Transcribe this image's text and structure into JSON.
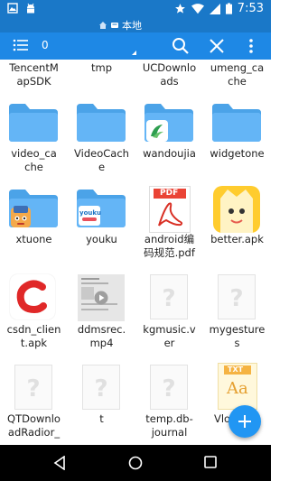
{
  "status": {
    "time": "7:53"
  },
  "tab": {
    "label": "本地"
  },
  "toolbar": {
    "selected_count": "0"
  },
  "files": [
    {
      "name": "TencentMapSDK",
      "lines": [
        "TencentM",
        "apSDK"
      ],
      "kind": "folder"
    },
    {
      "name": "tmp",
      "lines": [
        "tmp"
      ],
      "kind": "folder"
    },
    {
      "name": "UCDownloads",
      "lines": [
        "UCDownlo",
        "ads"
      ],
      "kind": "folder"
    },
    {
      "name": "umeng_cache",
      "lines": [
        "umeng_ca",
        "che"
      ],
      "kind": "folder"
    },
    {
      "name": "video_cache",
      "lines": [
        "video_ca",
        "che"
      ],
      "kind": "folder"
    },
    {
      "name": "VideoCache",
      "lines": [
        "VideoCach",
        "e"
      ],
      "kind": "folder"
    },
    {
      "name": "wandoujia",
      "lines": [
        "wandoujia"
      ],
      "kind": "folder-app"
    },
    {
      "name": "widgetone",
      "lines": [
        "widgetone"
      ],
      "kind": "folder"
    },
    {
      "name": "xtuone",
      "lines": [
        "xtuone"
      ],
      "kind": "folder-app"
    },
    {
      "name": "youku",
      "lines": [
        "youku"
      ],
      "kind": "folder-app"
    },
    {
      "name": "android编码规范.pdf",
      "lines": [
        "android编",
        "码规范.pdf"
      ],
      "kind": "pdf"
    },
    {
      "name": "better.apk",
      "lines": [
        "better.apk"
      ],
      "kind": "apk"
    },
    {
      "name": "csdn_client.apk",
      "lines": [
        "csdn_clien",
        "t.apk"
      ],
      "kind": "apk-csdn"
    },
    {
      "name": "ddmsrec.mp4",
      "lines": [
        "ddmsrec.",
        "mp4"
      ],
      "kind": "video"
    },
    {
      "name": "kgmusic.ver",
      "lines": [
        "kgmusic.v",
        "er"
      ],
      "kind": "unknown"
    },
    {
      "name": "mygestures",
      "lines": [
        "mygesture",
        "s"
      ],
      "kind": "unknown"
    },
    {
      "name": "QTDownloadRadior_",
      "lines": [
        "QTDownlo",
        "adRadior_"
      ],
      "kind": "unknown"
    },
    {
      "name": "t",
      "lines": [
        "t"
      ],
      "kind": "unknown"
    },
    {
      "name": "temp.db-journal",
      "lines": [
        "temp.db-",
        "journal"
      ],
      "kind": "unknown"
    },
    {
      "name": "Vlog.txt",
      "lines": [
        "Vlog.txt"
      ],
      "kind": "txt"
    }
  ],
  "icon_badges": {
    "pdf": "PDF",
    "txt": "TXT",
    "youku": "youku"
  },
  "colors": {
    "status_bar": "#1a78c8",
    "toolbar": "#1e88e5",
    "folder": "#64b5f6",
    "fab": "#2196f3"
  }
}
